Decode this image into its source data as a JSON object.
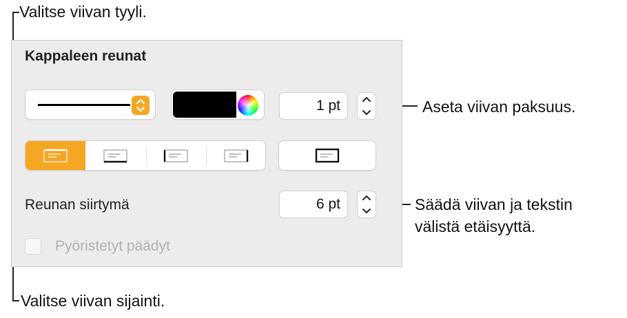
{
  "callouts": {
    "top": "Valitse viivan tyyli.",
    "thickness": "Aseta viivan paksuus.",
    "offset_line1": "Säädä viivan ja tekstin",
    "offset_line2": "välistä etäisyyttä.",
    "bottom": "Valitse viivan sijainti."
  },
  "panel": {
    "title": "Kappaleen reunat",
    "line_style": {
      "selected": "solid-line"
    },
    "color": {
      "value": "#000000"
    },
    "thickness": {
      "value": "1 pt"
    },
    "position_buttons": [
      {
        "name": "border-top",
        "selected": true
      },
      {
        "name": "border-bottom",
        "selected": false
      },
      {
        "name": "border-left",
        "selected": false
      },
      {
        "name": "border-right",
        "selected": false
      }
    ],
    "box_button": {
      "name": "border-all"
    },
    "offset": {
      "label": "Reunan siirtymä",
      "value": "6 pt"
    },
    "rounded": {
      "label": "Pyöristetyt päädyt",
      "checked": false,
      "enabled": false
    }
  },
  "colors": {
    "accent": "#f5a623",
    "panel_bg": "#ececec"
  }
}
